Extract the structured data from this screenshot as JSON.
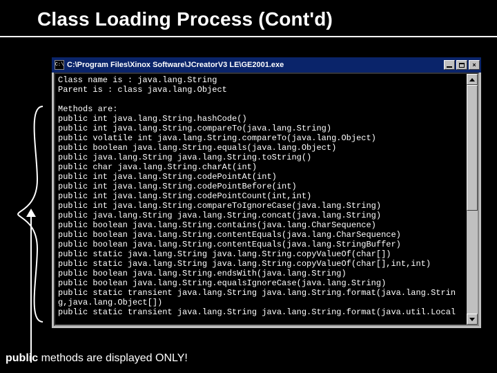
{
  "slide": {
    "title": "Class Loading Process (Cont'd)",
    "footnote_public": "public ",
    "footnote_rest": "methods are displayed ONLY!"
  },
  "console": {
    "title": "C:\\Program Files\\Xinox Software\\JCreatorV3 LE\\GE2001.exe",
    "icon_text": "C:\\",
    "lines": [
      "Class name is : java.lang.String",
      "Parent is : class java.lang.Object",
      "",
      "Methods are:",
      "public int java.lang.String.hashCode()",
      "public int java.lang.String.compareTo(java.lang.String)",
      "public volatile int java.lang.String.compareTo(java.lang.Object)",
      "public boolean java.lang.String.equals(java.lang.Object)",
      "public java.lang.String java.lang.String.toString()",
      "public char java.lang.String.charAt(int)",
      "public int java.lang.String.codePointAt(int)",
      "public int java.lang.String.codePointBefore(int)",
      "public int java.lang.String.codePointCount(int,int)",
      "public int java.lang.String.compareToIgnoreCase(java.lang.String)",
      "public java.lang.String java.lang.String.concat(java.lang.String)",
      "public boolean java.lang.String.contains(java.lang.CharSequence)",
      "public boolean java.lang.String.contentEquals(java.lang.CharSequence)",
      "public boolean java.lang.String.contentEquals(java.lang.StringBuffer)",
      "public static java.lang.String java.lang.String.copyValueOf(char[])",
      "public static java.lang.String java.lang.String.copyValueOf(char[],int,int)",
      "public boolean java.lang.String.endsWith(java.lang.String)",
      "public boolean java.lang.String.equalsIgnoreCase(java.lang.String)",
      "public static transient java.lang.String java.lang.String.format(java.lang.Strin",
      "g,java.lang.Object[])",
      "public static transient java.lang.String java.lang.String.format(java.util.Local"
    ]
  }
}
